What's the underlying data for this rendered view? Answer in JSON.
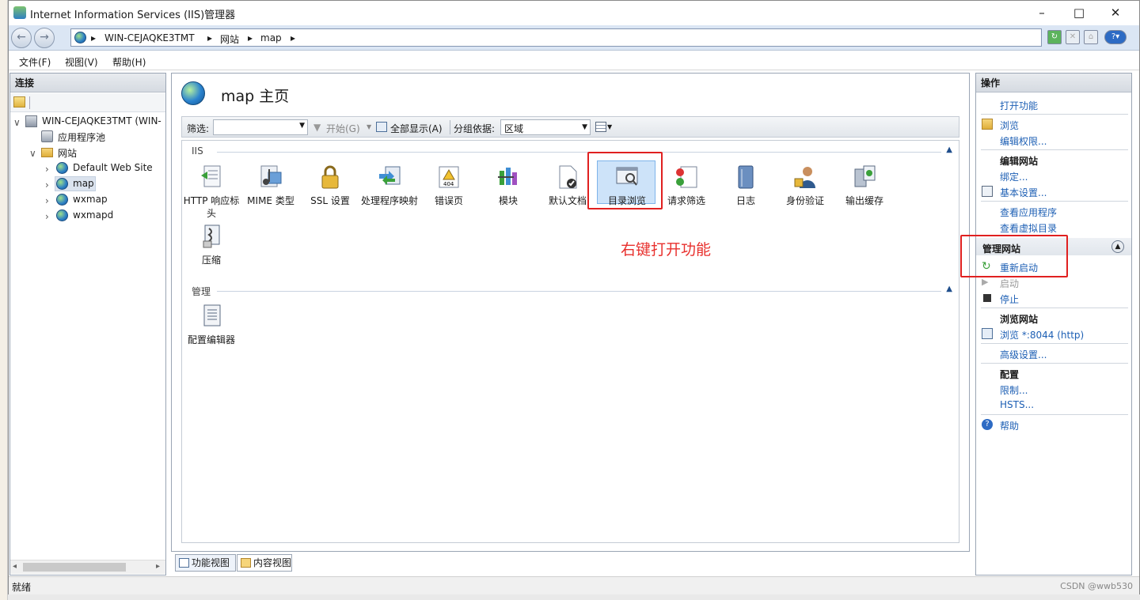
{
  "window": {
    "title": "Internet Information Services (IIS)管理器"
  },
  "address": {
    "segments": [
      "WIN-CEJAQKE3TMT",
      "网站",
      "map"
    ]
  },
  "menu": [
    "文件(F)",
    "视图(V)",
    "帮助(H)"
  ],
  "connections": {
    "title": "连接",
    "server": "WIN-CEJAQKE3TMT (WIN-",
    "app_pools": "应用程序池",
    "sites_label": "网站",
    "sites": [
      "Default Web Site",
      "map",
      "wxmap",
      "wxmapd"
    ]
  },
  "center": {
    "title": "map 主页",
    "filter_label": "筛选:",
    "start_btn": "开始(G)",
    "show_all_btn": "全部显示(A)",
    "group_label": "分组依据:",
    "group_value": "区域",
    "sections": [
      {
        "name": "IIS",
        "items": [
          "HTTP 响应标头",
          "MIME 类型",
          "SSL 设置",
          "处理程序映射",
          "错误页",
          "模块",
          "默认文档",
          "目录浏览",
          "请求筛选",
          "日志",
          "身份验证",
          "输出缓存",
          "压缩"
        ]
      },
      {
        "name": "管理",
        "items": [
          "配置编辑器"
        ]
      }
    ],
    "annotation": "右键打开功能",
    "tabs": [
      "功能视图",
      "内容视图"
    ]
  },
  "actions": {
    "title": "操作",
    "open_feature": "打开功能",
    "browse": "浏览",
    "edit_perms": "编辑权限...",
    "edit_site": "编辑网站",
    "bindings": "绑定...",
    "basic_settings": "基本设置...",
    "view_apps": "查看应用程序",
    "view_vdirs": "查看虚拟目录",
    "manage_site": "管理网站",
    "restart": "重新启动",
    "start": "启动",
    "stop": "停止",
    "browse_site": "浏览网站",
    "browse_port": "浏览 *:8044 (http)",
    "advanced": "高级设置...",
    "config": "配置",
    "limits": "限制...",
    "hsts": "HSTS...",
    "help": "帮助"
  },
  "status": {
    "text": "就绪",
    "watermark": "CSDN @wwb530"
  },
  "colors": {
    "link": "#1d5fb4",
    "highlight": "#e02020",
    "annotation": "#e8302d"
  }
}
